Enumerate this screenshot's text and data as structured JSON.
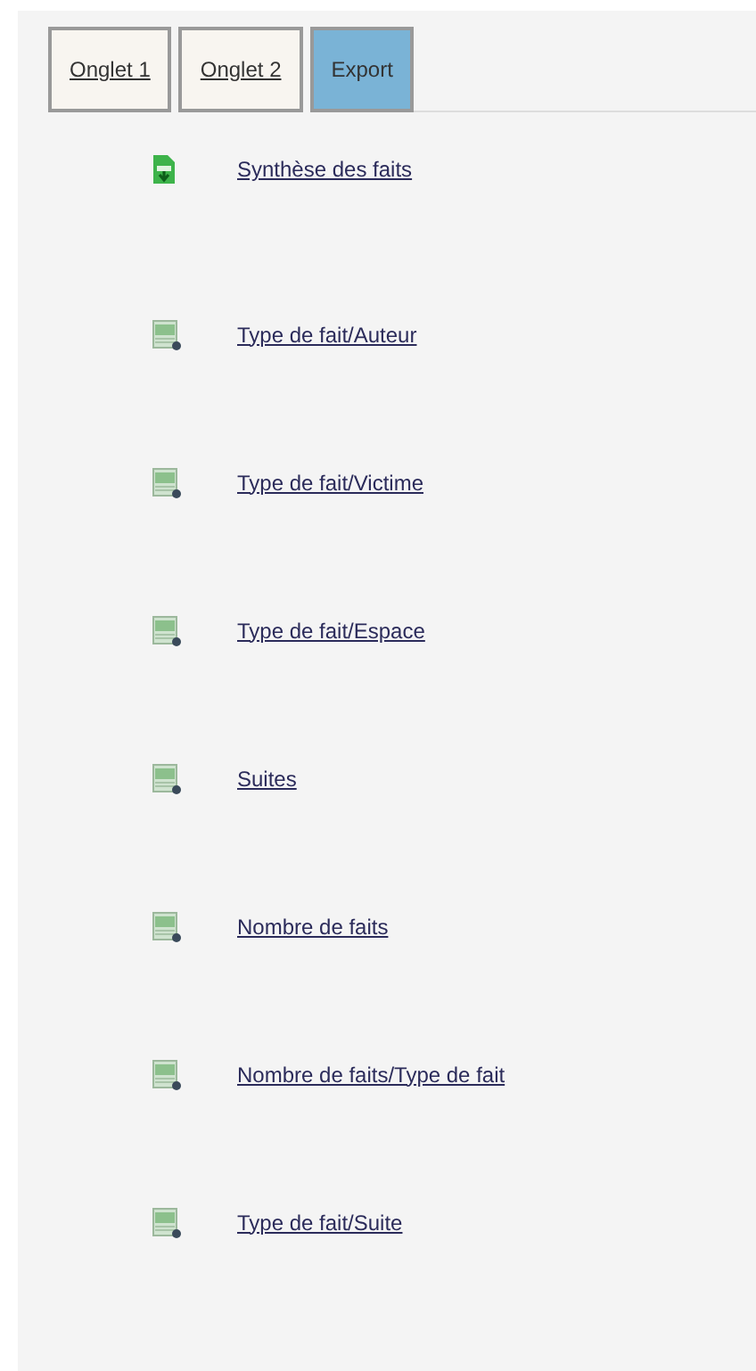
{
  "tabs": [
    {
      "label": "Onglet 1",
      "selected": false
    },
    {
      "label": "Onglet 2",
      "selected": false
    },
    {
      "label": "Export",
      "selected": true
    }
  ],
  "exports": [
    {
      "label": "Synthèse des faits",
      "kind": "document"
    },
    {
      "label": "Type de fait/Auteur",
      "kind": "spreadsheet"
    },
    {
      "label": "Type de fait/Victime",
      "kind": "spreadsheet"
    },
    {
      "label": "Type de fait/Espace",
      "kind": "spreadsheet"
    },
    {
      "label": "Suites",
      "kind": "spreadsheet"
    },
    {
      "label": "Nombre de faits",
      "kind": "spreadsheet"
    },
    {
      "label": "Nombre de faits/Type de fait",
      "kind": "spreadsheet"
    },
    {
      "label": "Type de fait/Suite",
      "kind": "spreadsheet"
    }
  ]
}
